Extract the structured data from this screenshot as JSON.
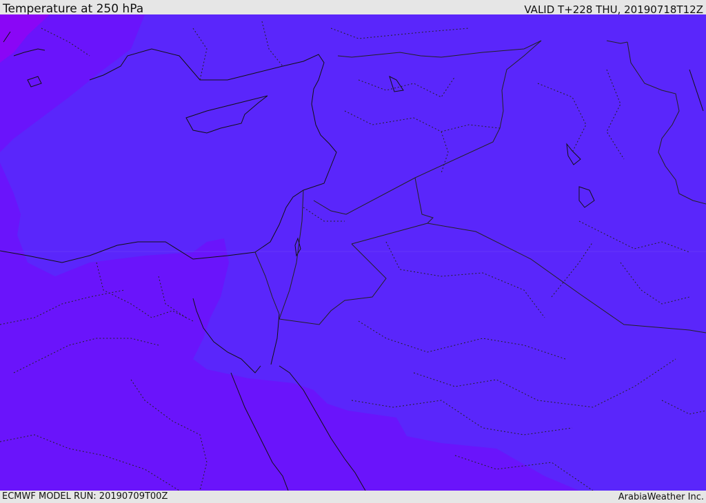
{
  "header": {
    "title": "Temperature at 250 hPa",
    "valid_time": "VALID T+228 THU, 20190718T12Z"
  },
  "footer": {
    "model_run": "ECMWF MODEL RUN: 20190709T00Z",
    "credit": "ArabiaWeather Inc."
  },
  "map": {
    "colors": {
      "base_zone": "#6a14fb",
      "warm_zone": "#5a26fb",
      "northwest_zone": "#8a06f6",
      "coastline": "#111111",
      "border": "#222222"
    }
  }
}
